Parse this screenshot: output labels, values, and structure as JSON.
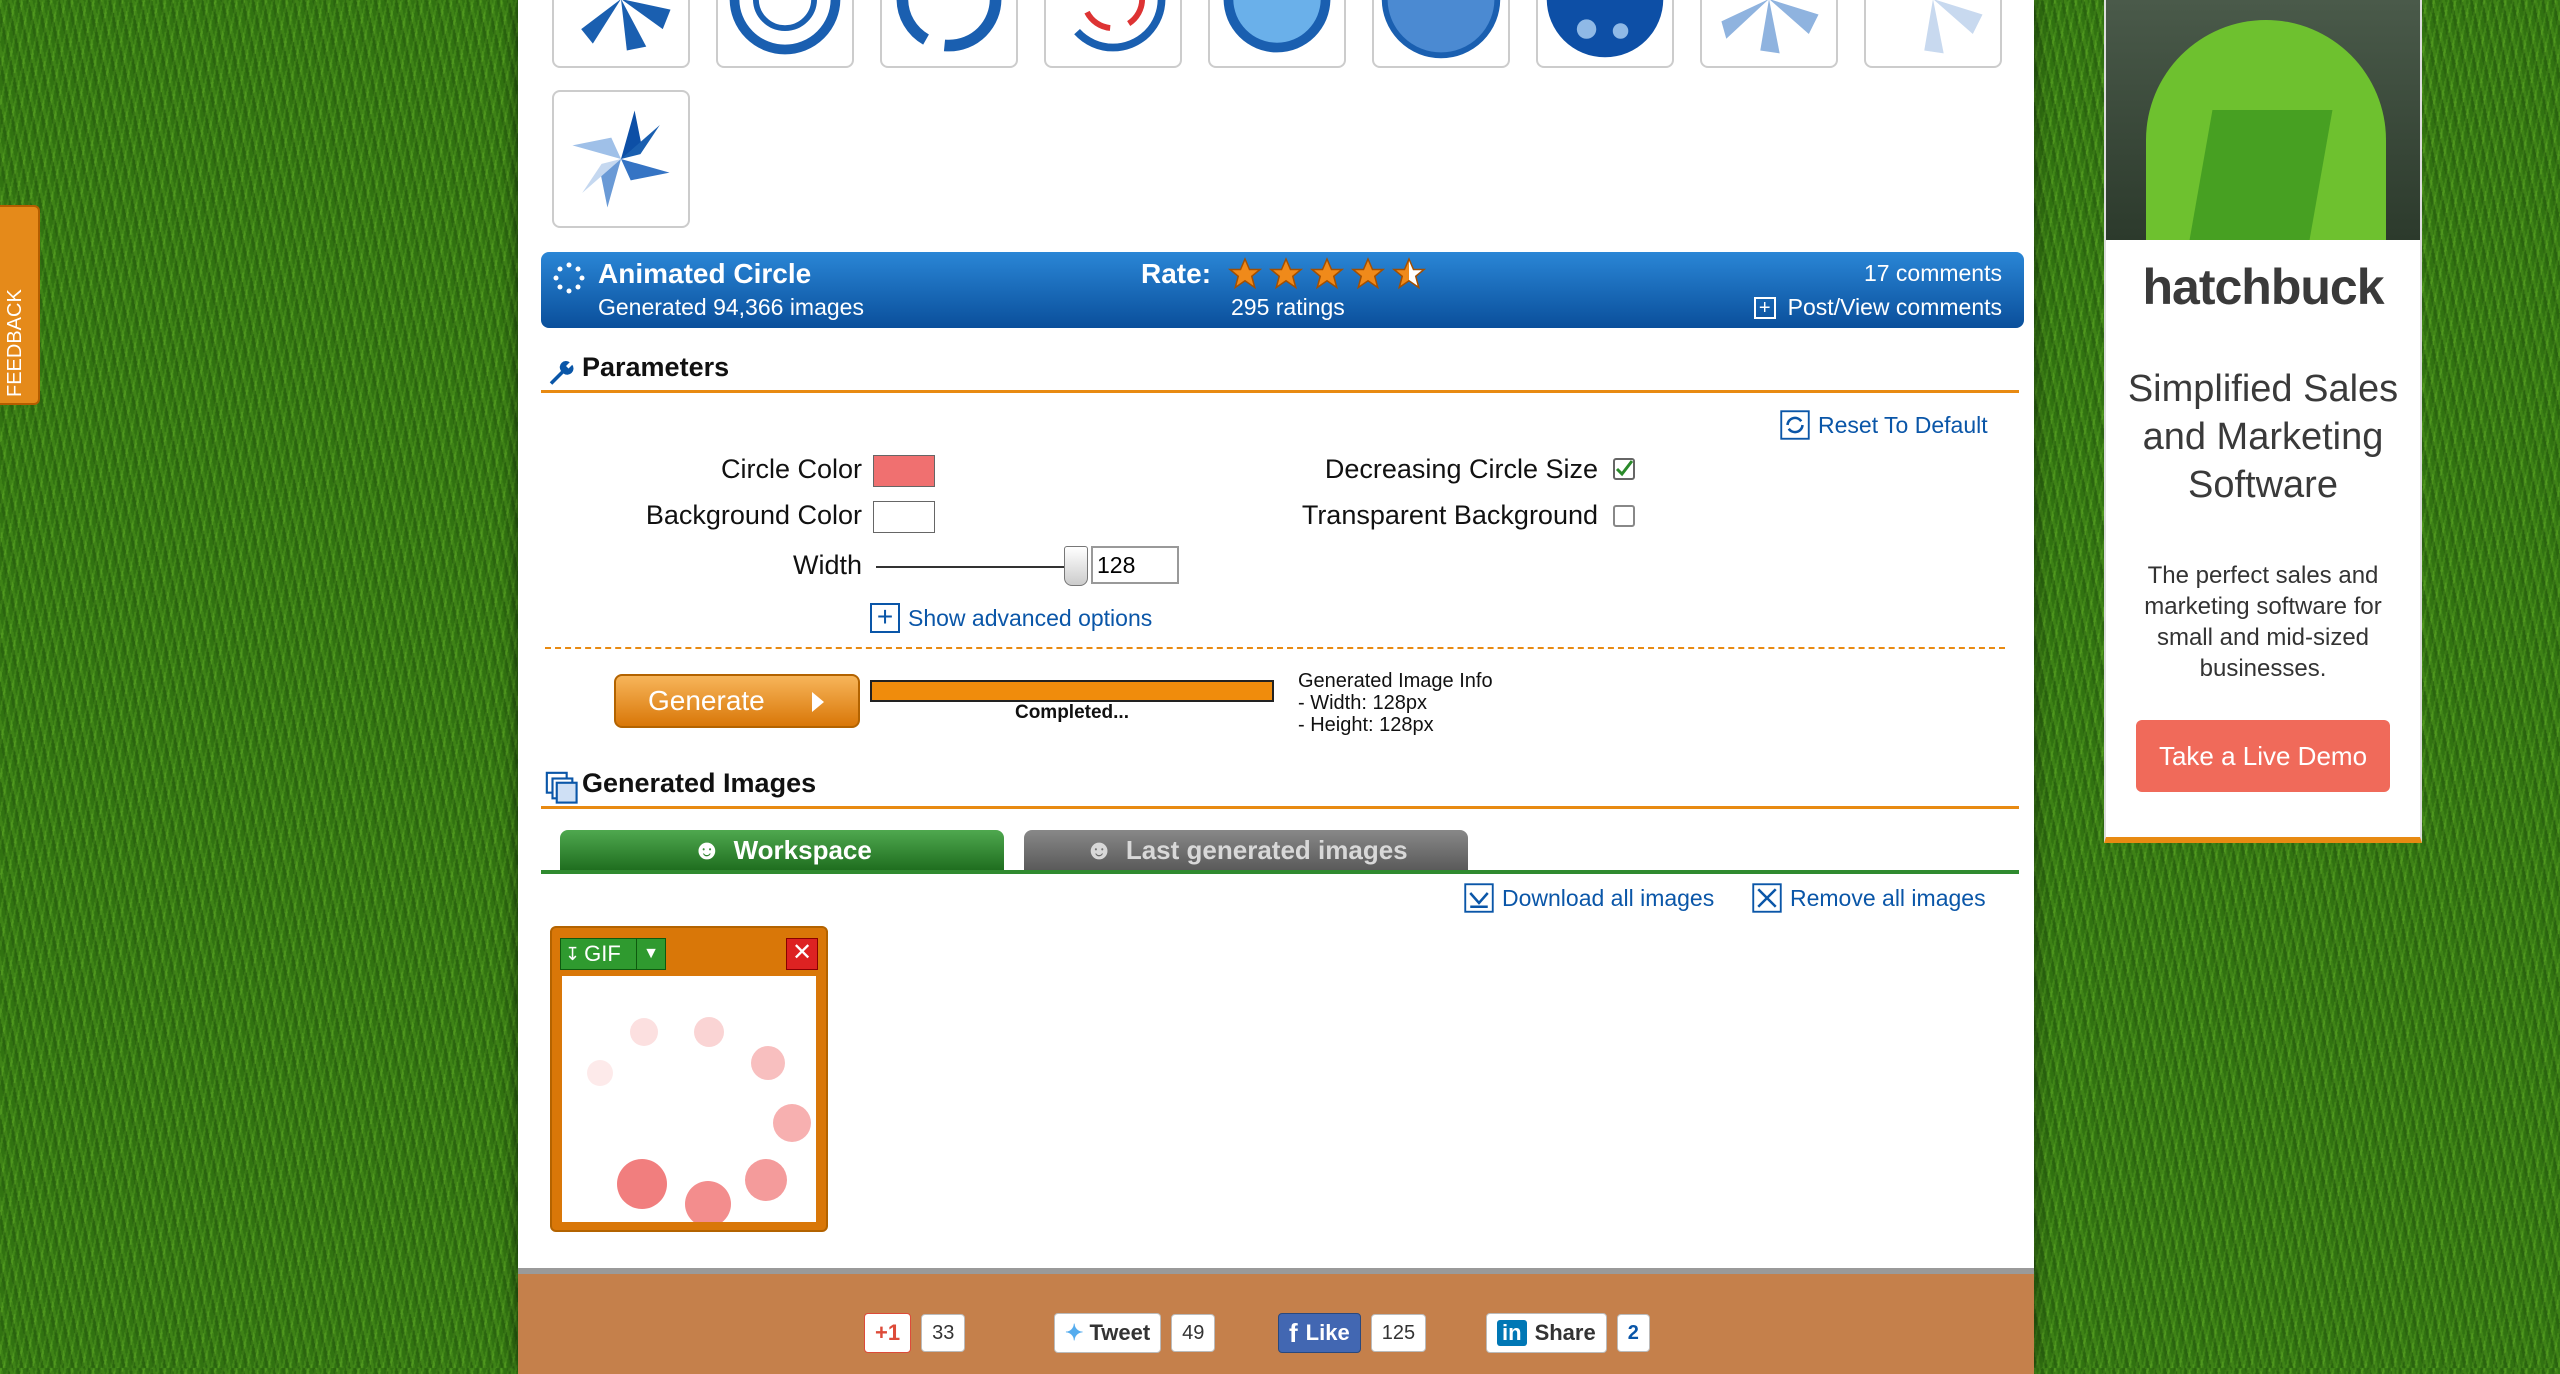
{
  "feedback": {
    "label": "FEEDBACK"
  },
  "loader": {
    "title": "Animated Circle",
    "generated": "Generated 94,366 images",
    "rate_label": "Rate:",
    "rating": 4.5,
    "ratings": "295 ratings",
    "comments": "17 comments",
    "post_view": "Post/View comments"
  },
  "parameters": {
    "title": "Parameters",
    "reset": "Reset To Default",
    "circle_color_label": "Circle Color",
    "circle_color": "#f07070",
    "background_color_label": "Background Color",
    "background_color": "#ffffff",
    "width_label": "Width",
    "width_value": "128",
    "decreasing_label": "Decreasing Circle Size",
    "decreasing_checked": true,
    "transparent_label": "Transparent Background",
    "transparent_checked": false,
    "advanced": "Show advanced options"
  },
  "generate": {
    "button": "Generate",
    "progress": 1.0,
    "status": "Completed...",
    "info_title": "Generated Image Info",
    "info_width": "- Width: 128px",
    "info_height": "- Height: 128px"
  },
  "generated_images": {
    "title": "Generated Images",
    "tab_workspace": "Workspace",
    "tab_last": "Last generated images",
    "download_all": "Download all images",
    "remove_all": "Remove all images",
    "item_format": "GIF"
  },
  "ad": {
    "brand": "hatchbuck",
    "headline": "Simplified Sales and Marketing Software",
    "body": "The perfect sales and marketing software for small and mid-sized businesses.",
    "cta": "Take a Live Demo"
  },
  "social": {
    "gplus": "+1",
    "gplus_count": "33",
    "tweet": "Tweet",
    "tweet_count": "49",
    "like": "Like",
    "like_count": "125",
    "share": "Share",
    "share_count": "2"
  },
  "colors": {
    "brand_blue": "#0a56a8",
    "accent_orange": "#e88a12",
    "workspace_green": "#2f8a2f"
  }
}
